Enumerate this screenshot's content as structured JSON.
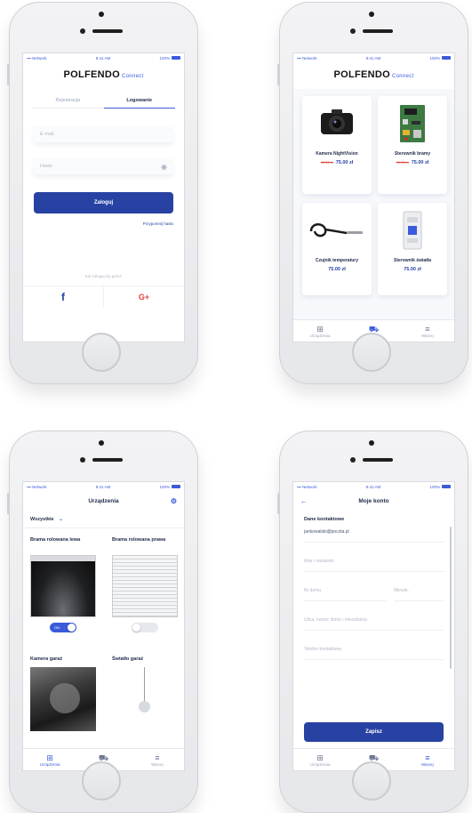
{
  "status": {
    "carrier": "Network",
    "time": "9:41 AM",
    "battery": "100%"
  },
  "brand": {
    "name": "POLFENDO",
    "suffix": "Connect",
    "accent": "#2742a3"
  },
  "login": {
    "tab_register": "Rejestracja",
    "tab_login": "Logowanie",
    "email_placeholder": "E-mail",
    "password_placeholder": "Hasło",
    "submit": "Zaloguj",
    "forgot": "Przypomnij hasło",
    "social_prompt": "lub zaloguj się przez",
    "facebook": "f",
    "google": "G+"
  },
  "shop": {
    "products": [
      {
        "name": "Kamera NightVision",
        "old_price": "99.00 zł",
        "price": "75.00 zł"
      },
      {
        "name": "Sterownik bramy",
        "old_price": "99.00 zł",
        "price": "75.00 zł"
      },
      {
        "name": "Czujnik temperatury",
        "price": "75.00 zł"
      },
      {
        "name": "Sterownik światła",
        "price": "75.00 zł"
      }
    ]
  },
  "devices": {
    "title": "Urządzenia",
    "filter": "Wszystkie",
    "items": [
      {
        "name": "Brama rolowana lewa",
        "toggle_label": "ON",
        "on": true
      },
      {
        "name": "Brama rolowana prawa",
        "on": false
      },
      {
        "name": "Kamera garaż"
      },
      {
        "name": "Światło garaż"
      }
    ]
  },
  "account": {
    "title": "Moje konto",
    "section": "Dane kontaktowe",
    "email_value": "jankowalski@poczta.pl",
    "name_placeholder": "Imię i nazwisko",
    "house_placeholder": "Nr domu",
    "apartment_placeholder": "Mieszk.",
    "street_placeholder": "Ulica, numer domu i mieszkania",
    "phone_placeholder": "Telefon kontaktowy",
    "save": "Zapisz"
  },
  "tabbar": {
    "devices": "Urządzenia",
    "shop": "Sklep",
    "more": "Więcej"
  }
}
